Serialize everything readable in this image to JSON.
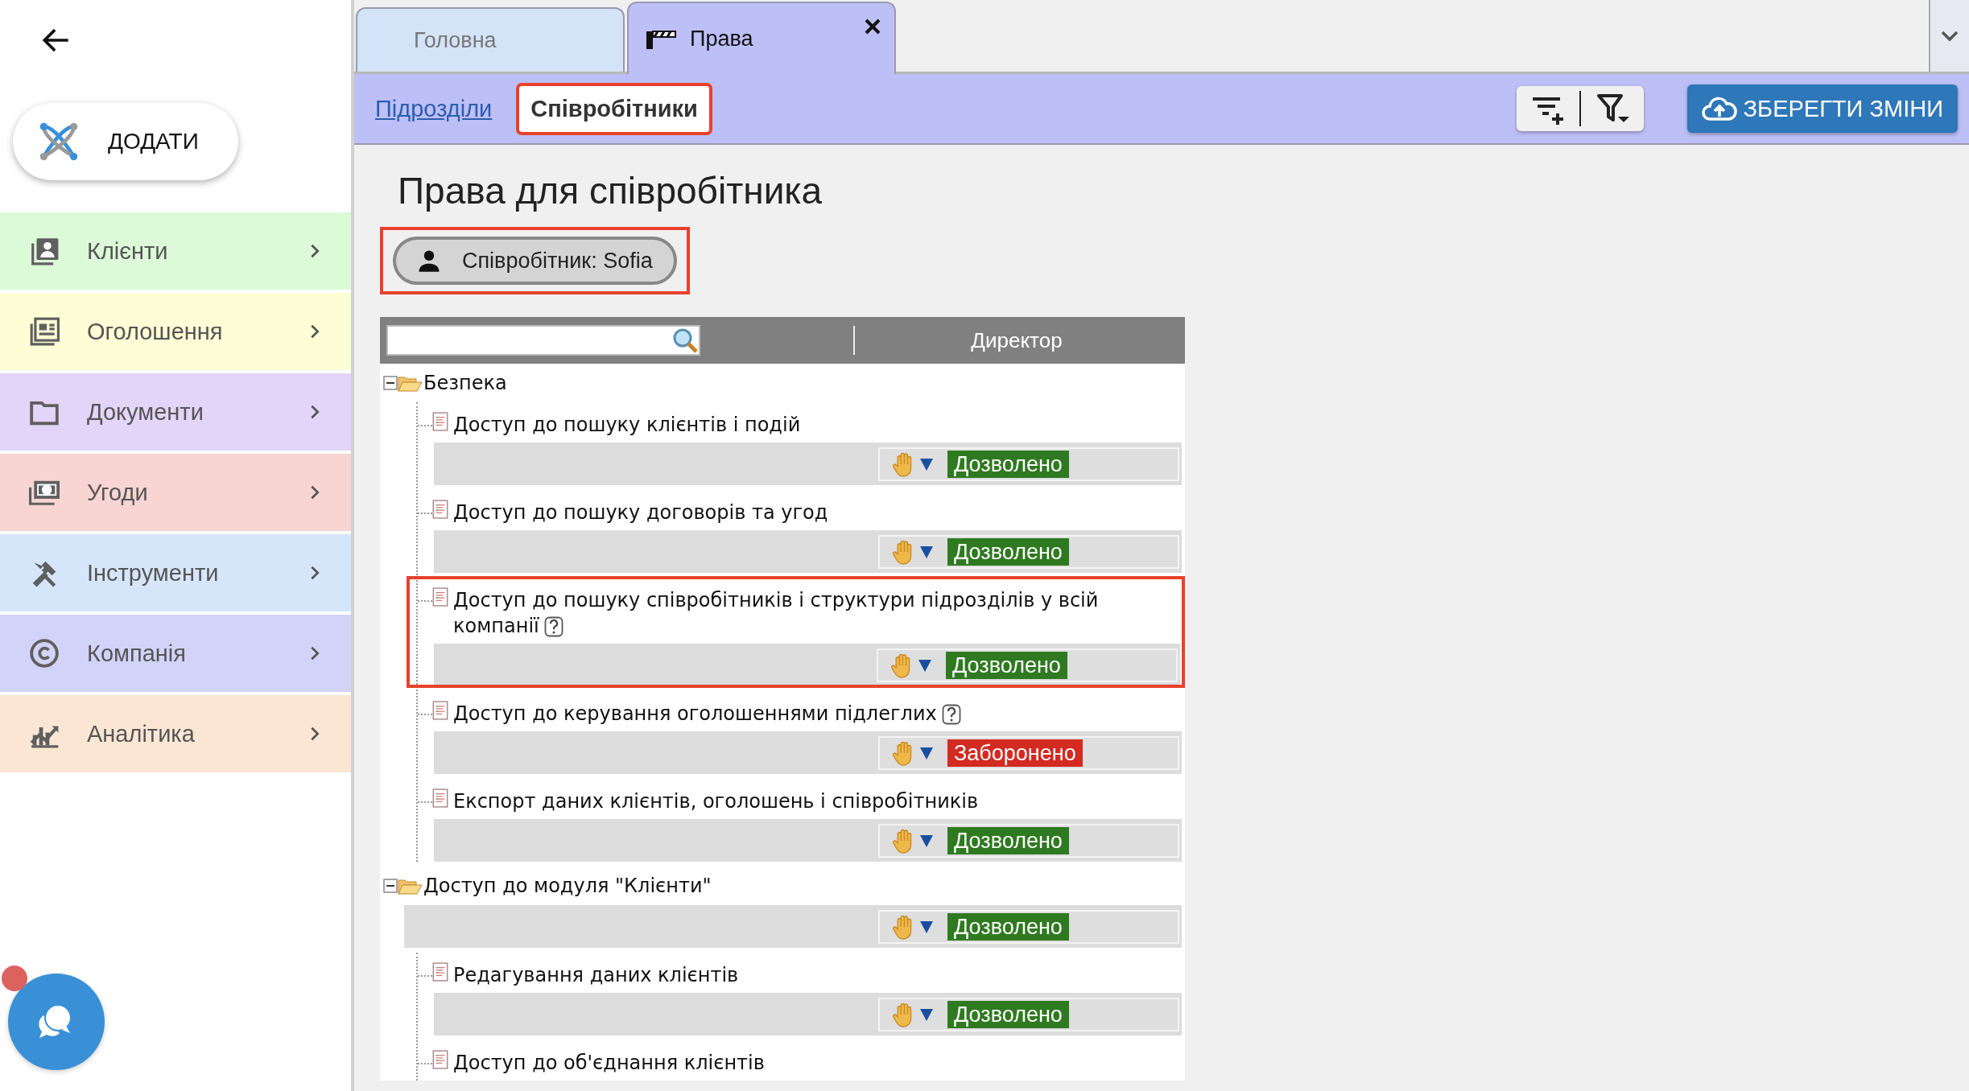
{
  "add_button": {
    "label": "ДОДАТИ"
  },
  "sidebar": {
    "items": [
      {
        "label": "Клієнти",
        "color": "#dcf9d8"
      },
      {
        "label": "Оголошення",
        "color": "#fdfdd6"
      },
      {
        "label": "Документи",
        "color": "#e3d4f9"
      },
      {
        "label": "Угоди",
        "color": "#f8d4d3"
      },
      {
        "label": "Інструменти",
        "color": "#d5e6fb"
      },
      {
        "label": "Компанія",
        "color": "#d2d3f8"
      },
      {
        "label": "Аналітика",
        "color": "#fbe6d4"
      }
    ]
  },
  "chat": {
    "unread": true
  },
  "tabs": [
    {
      "label": "Головна",
      "selected": false,
      "icon": false,
      "closable": false
    },
    {
      "label": "Права",
      "selected": true,
      "icon": true,
      "closable": true
    }
  ],
  "subtabs": [
    {
      "label": "Підрозділи",
      "selected": false,
      "highlighted": false
    },
    {
      "label": "Співробітники",
      "selected": true,
      "highlighted": true
    }
  ],
  "save_button": {
    "label": "ЗБЕРЕГТИ ЗМІНИ"
  },
  "page_title": "Права для співробітника",
  "employee_chip": {
    "label": "Співробітник: Sofia",
    "highlighted": true
  },
  "tree": {
    "column": "Директор",
    "nodes": [
      {
        "kind": "group",
        "label": "Безпека",
        "expanded": true,
        "children": [
          {
            "kind": "item",
            "label": "Доступ до пошуку клієнтів і подій",
            "help": false,
            "highlighted": false,
            "permission": {
              "color": "#2f7a20",
              "label": "Дозволено"
            }
          },
          {
            "kind": "item",
            "label": "Доступ до пошуку договорів та угод",
            "help": false,
            "highlighted": false,
            "permission": {
              "color": "#2f7a20",
              "label": "Дозволено"
            }
          },
          {
            "kind": "item",
            "label": "Доступ до пошуку співробітників і структури підрозділів у всій компанії",
            "help": true,
            "highlighted": true,
            "permission": {
              "color": "#2f7a20",
              "label": "Дозволено"
            }
          },
          {
            "kind": "item",
            "label": "Доступ до керування оголошеннями підлеглих",
            "help": true,
            "highlighted": false,
            "permission": {
              "color": "#d32a22",
              "label": "Заборонено"
            }
          },
          {
            "kind": "item",
            "label": "Експорт даних клієнтів, оголошень і співробітників",
            "help": false,
            "highlighted": false,
            "permission": {
              "color": "#2f7a20",
              "label": "Дозволено"
            }
          }
        ]
      },
      {
        "kind": "group",
        "label": "Доступ до модуля \"Клієнти\"",
        "expanded": true,
        "permission": {
          "color": "#2f7a20",
          "label": "Дозволено"
        },
        "children": [
          {
            "kind": "item",
            "label": "Редагування даних клієнтів",
            "help": false,
            "highlighted": false,
            "permission": {
              "color": "#2f7a20",
              "label": "Дозволено"
            }
          },
          {
            "kind": "item",
            "label": "Доступ до об'єднання клієнтів",
            "help": false,
            "highlighted": false
          }
        ]
      }
    ]
  }
}
